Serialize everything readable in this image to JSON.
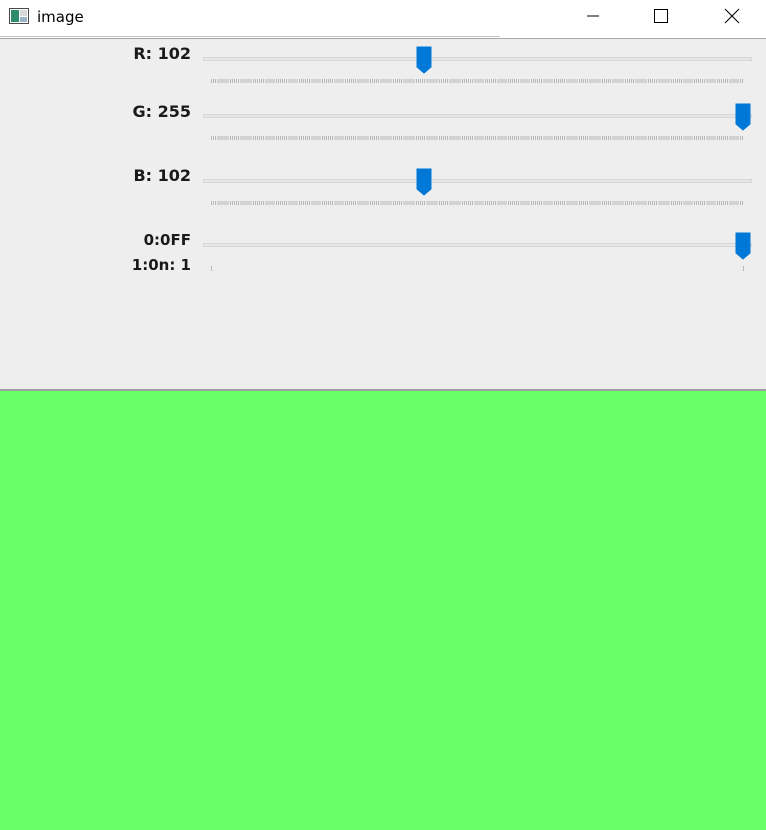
{
  "window": {
    "title": "image",
    "icon": "image-window-icon",
    "controls": [
      "minimize-icon",
      "maximize-icon",
      "close-icon"
    ]
  },
  "trackbars": [
    {
      "label": "R: 102",
      "value": 102,
      "max": 255,
      "ticks": true
    },
    {
      "label": "G: 255",
      "value": 255,
      "max": 255,
      "ticks": true
    },
    {
      "label": "B: 102",
      "value": 102,
      "max": 255,
      "ticks": true
    },
    {
      "label_line1": "0:0FF",
      "label_line2": "1:0n: 1",
      "value": 1,
      "max": 1,
      "ticks": false
    }
  ],
  "colors": {
    "image_fill": "#66ff66",
    "thumb": "#0078d7",
    "panel_bg": "#eeeeee"
  }
}
